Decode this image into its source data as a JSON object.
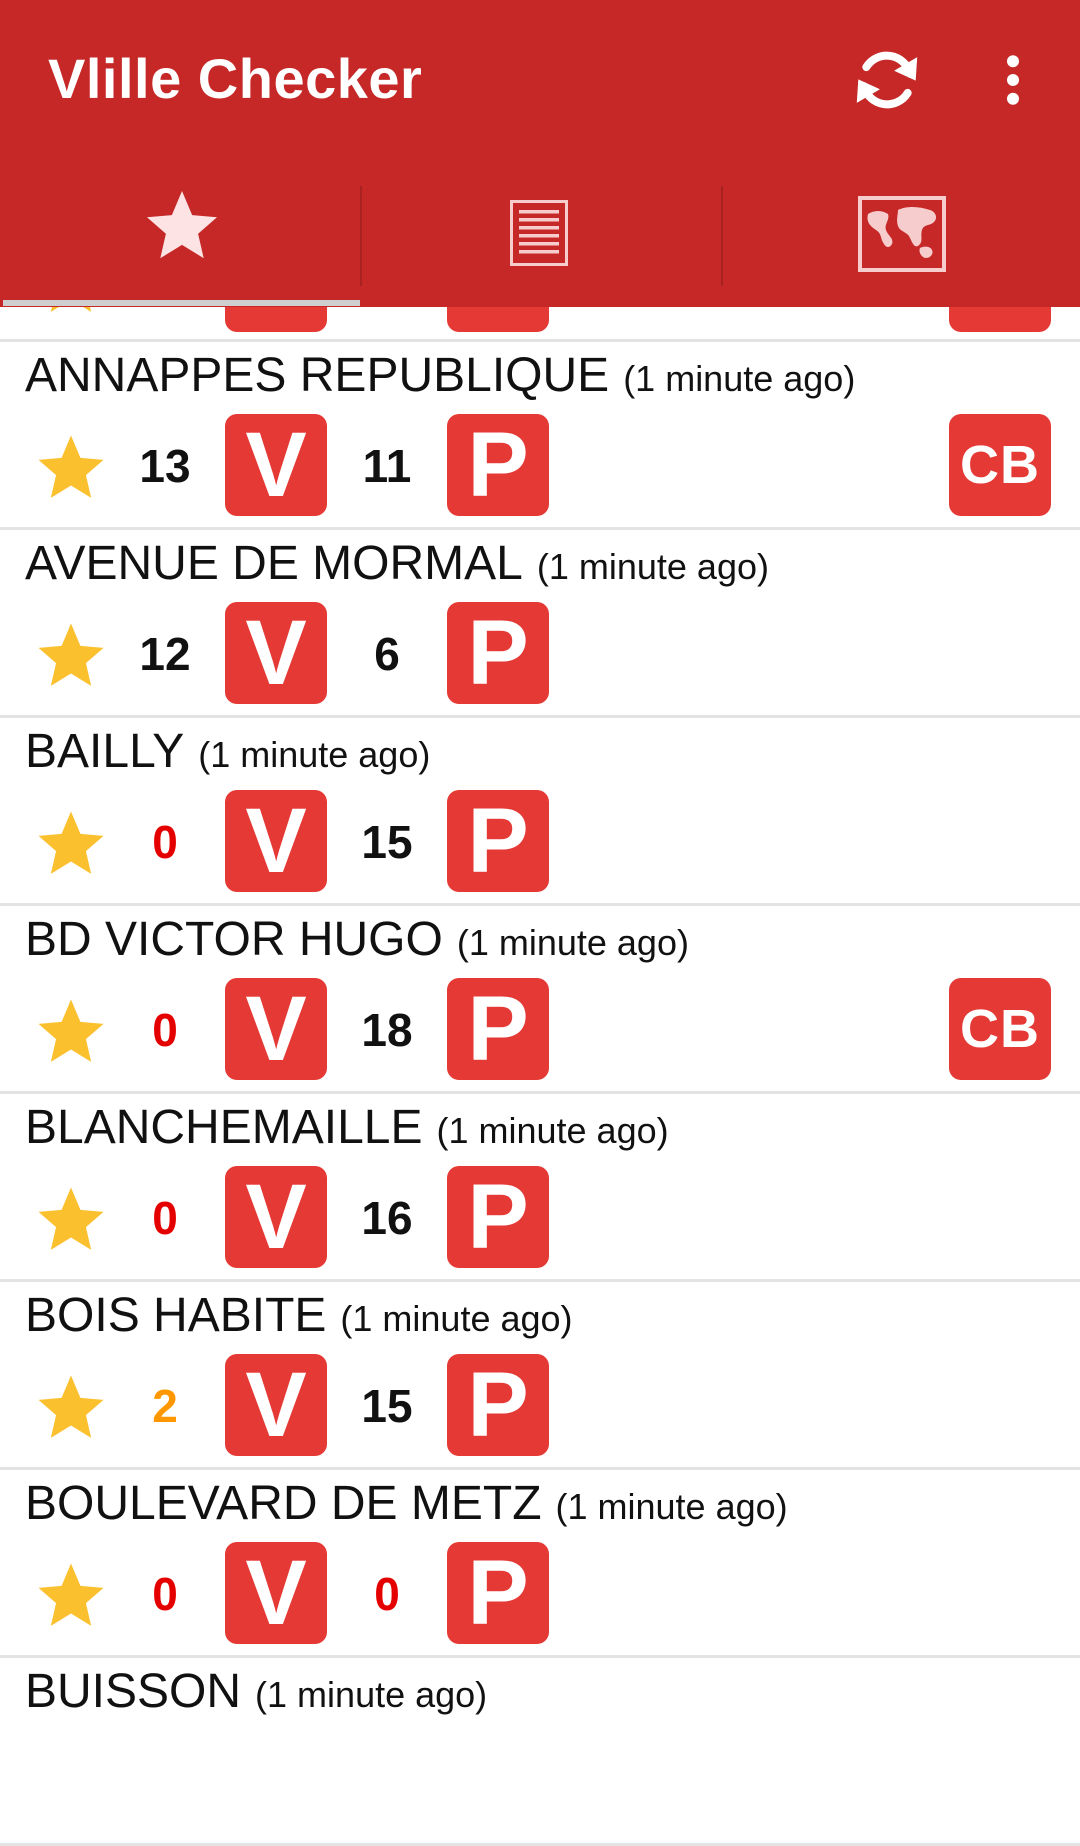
{
  "app_bar": {
    "title": "Vlille Checker",
    "color": "#c62828",
    "actions": [
      {
        "icon": "refresh-icon"
      },
      {
        "icon": "more-vert-icon"
      }
    ]
  },
  "tabs": [
    {
      "icon": "star-icon",
      "selected": true
    },
    {
      "icon": "list-icon",
      "selected": false
    },
    {
      "icon": "map-icon",
      "selected": false
    }
  ],
  "badges": {
    "bikes": "V",
    "places": "P",
    "card": "CB",
    "color": "#e53935"
  },
  "status_colors": {
    "normal": "#111111",
    "empty": "#e50000",
    "low": "#ff9800",
    "favorite_star": "#fbc02d"
  },
  "stations": [
    {
      "name": "ANNAPPES REPUBLIQUE",
      "updated": "(1 minute ago)",
      "bikes": "13",
      "bikes_status": "normal",
      "places": "11",
      "places_status": "normal",
      "card_payment": true
    },
    {
      "name": "AVENUE DE MORMAL",
      "updated": "(1 minute ago)",
      "bikes": "12",
      "bikes_status": "normal",
      "places": "6",
      "places_status": "normal",
      "card_payment": false
    },
    {
      "name": "BAILLY",
      "updated": "(1 minute ago)",
      "bikes": "0",
      "bikes_status": "empty",
      "places": "15",
      "places_status": "normal",
      "card_payment": false
    },
    {
      "name": "BD VICTOR HUGO",
      "updated": "(1 minute ago)",
      "bikes": "0",
      "bikes_status": "empty",
      "places": "18",
      "places_status": "normal",
      "card_payment": true
    },
    {
      "name": "BLANCHEMAILLE",
      "updated": "(1 minute ago)",
      "bikes": "0",
      "bikes_status": "empty",
      "places": "16",
      "places_status": "normal",
      "card_payment": false
    },
    {
      "name": "BOIS HABITE",
      "updated": "(1 minute ago)",
      "bikes": "2",
      "bikes_status": "low",
      "places": "15",
      "places_status": "normal",
      "card_payment": false
    },
    {
      "name": "BOULEVARD DE METZ",
      "updated": "(1 minute ago)",
      "bikes": "0",
      "bikes_status": "empty",
      "places": "0",
      "places_status": "empty",
      "card_payment": false
    },
    {
      "name": "BUISSON",
      "updated": "(1 minute ago)"
    }
  ]
}
